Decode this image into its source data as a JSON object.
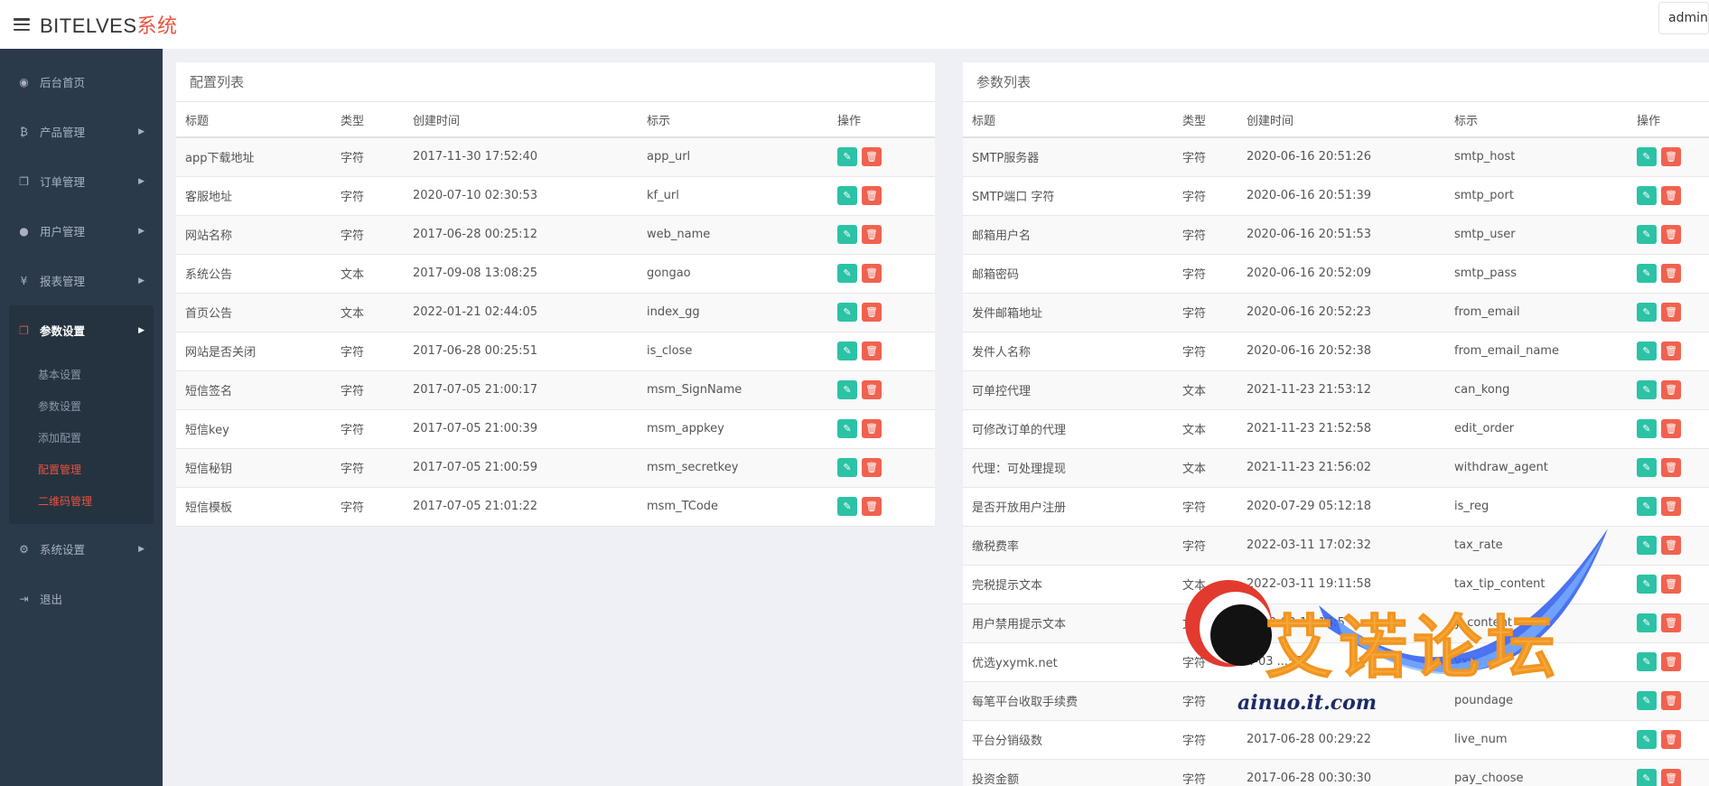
{
  "header": {
    "brand_main": "BITELVES",
    "brand_accent": "系统",
    "user": "admin"
  },
  "sidebar": {
    "items": [
      {
        "label": "后台首页",
        "icon": "dashboard-icon",
        "glyph": "◉",
        "arrow": false
      },
      {
        "label": "产品管理",
        "icon": "bitcoin-icon",
        "glyph": "₿",
        "arrow": true
      },
      {
        "label": "订单管理",
        "icon": "copy-icon",
        "glyph": "❐",
        "arrow": true
      },
      {
        "label": "用户管理",
        "icon": "user-icon",
        "glyph": "●",
        "arrow": true
      },
      {
        "label": "报表管理",
        "icon": "yen-icon",
        "glyph": "¥",
        "arrow": true
      },
      {
        "label": "参数设置",
        "icon": "copy-icon",
        "glyph": "❐",
        "arrow": true,
        "active": true
      },
      {
        "label": "系统设置",
        "icon": "gears-icon",
        "glyph": "⚙",
        "arrow": true
      },
      {
        "label": "退出",
        "icon": "sign-out-icon",
        "glyph": "⇥",
        "arrow": false
      }
    ],
    "submenu": [
      {
        "label": "基本设置",
        "highlight": false
      },
      {
        "label": "参数设置",
        "highlight": false
      },
      {
        "label": "添加配置",
        "highlight": false
      },
      {
        "label": "配置管理",
        "highlight": true
      },
      {
        "label": "二维码管理",
        "highlight": true
      }
    ]
  },
  "config_panel": {
    "title": "配置列表",
    "columns": [
      "标题",
      "类型",
      "创建时间",
      "标示",
      "操作"
    ],
    "rows": [
      [
        "app下载地址",
        "字符",
        "2017-11-30 17:52:40",
        "app_url"
      ],
      [
        "客服地址",
        "字符",
        "2020-07-10 02:30:53",
        "kf_url"
      ],
      [
        "网站名称",
        "字符",
        "2017-06-28 00:25:12",
        "web_name"
      ],
      [
        "系统公告",
        "文本",
        "2017-09-08 13:08:25",
        "gongao"
      ],
      [
        "首页公告",
        "文本",
        "2022-01-21 02:44:05",
        "index_gg"
      ],
      [
        "网站是否关闭",
        "字符",
        "2017-06-28 00:25:51",
        "is_close"
      ],
      [
        "短信签名",
        "字符",
        "2017-07-05 21:00:17",
        "msm_SignName"
      ],
      [
        "短信key",
        "字符",
        "2017-07-05 21:00:39",
        "msm_appkey"
      ],
      [
        "短信秘钥",
        "字符",
        "2017-07-05 21:00:59",
        "msm_secretkey"
      ],
      [
        "短信模板",
        "字符",
        "2017-07-05 21:01:22",
        "msm_TCode"
      ]
    ]
  },
  "param_panel": {
    "title": "参数列表",
    "columns": [
      "标题",
      "类型",
      "创建时间",
      "标示",
      "操作"
    ],
    "rows": [
      [
        "SMTP服务器",
        "字符",
        "2020-06-16 20:51:26",
        "smtp_host"
      ],
      [
        "SMTP端口 字符",
        "字符",
        "2020-06-16 20:51:39",
        "smtp_port"
      ],
      [
        "邮箱用户名",
        "字符",
        "2020-06-16 20:51:53",
        "smtp_user"
      ],
      [
        "邮箱密码",
        "字符",
        "2020-06-16 20:52:09",
        "smtp_pass"
      ],
      [
        "发件邮箱地址",
        "字符",
        "2020-06-16 20:52:23",
        "from_email"
      ],
      [
        "发件人名称",
        "字符",
        "2020-06-16 20:52:38",
        "from_email_name"
      ],
      [
        "可单控代理",
        "文本",
        "2021-11-23 21:53:12",
        "can_kong"
      ],
      [
        "可修改订单的代理",
        "文本",
        "2021-11-23 21:52:58",
        "edit_order"
      ],
      [
        "代理：可处理提现",
        "文本",
        "2021-11-23 21:56:02",
        "withdraw_agent"
      ],
      [
        "是否开放用户注册",
        "字符",
        "2020-07-29 05:12:18",
        "is_reg"
      ],
      [
        "缴税费率",
        "字符",
        "2022-03-11 17:02:32",
        "tax_rate"
      ],
      [
        "完税提示文本",
        "文本",
        "2022-03-11 19:11:58",
        "tax_tip_content"
      ],
      [
        "用户禁用提示文本",
        "文本",
        "2022-03-12 14:5",
        "y_content"
      ],
      [
        "优选yxymk.net",
        "字符",
        "4-03 ...58",
        "yxymk"
      ],
      [
        "每笔平台收取手续费",
        "字符",
        "",
        "poundage"
      ],
      [
        "平台分销级数",
        "字符",
        "2017-06-28 00:29:22",
        "live_num"
      ],
      [
        "投资金额",
        "字符",
        "2017-06-28 00:30:30",
        "pay_choose"
      ]
    ]
  },
  "watermark": {
    "text": "艾诺论坛",
    "sub": "ainuo.it.com"
  }
}
